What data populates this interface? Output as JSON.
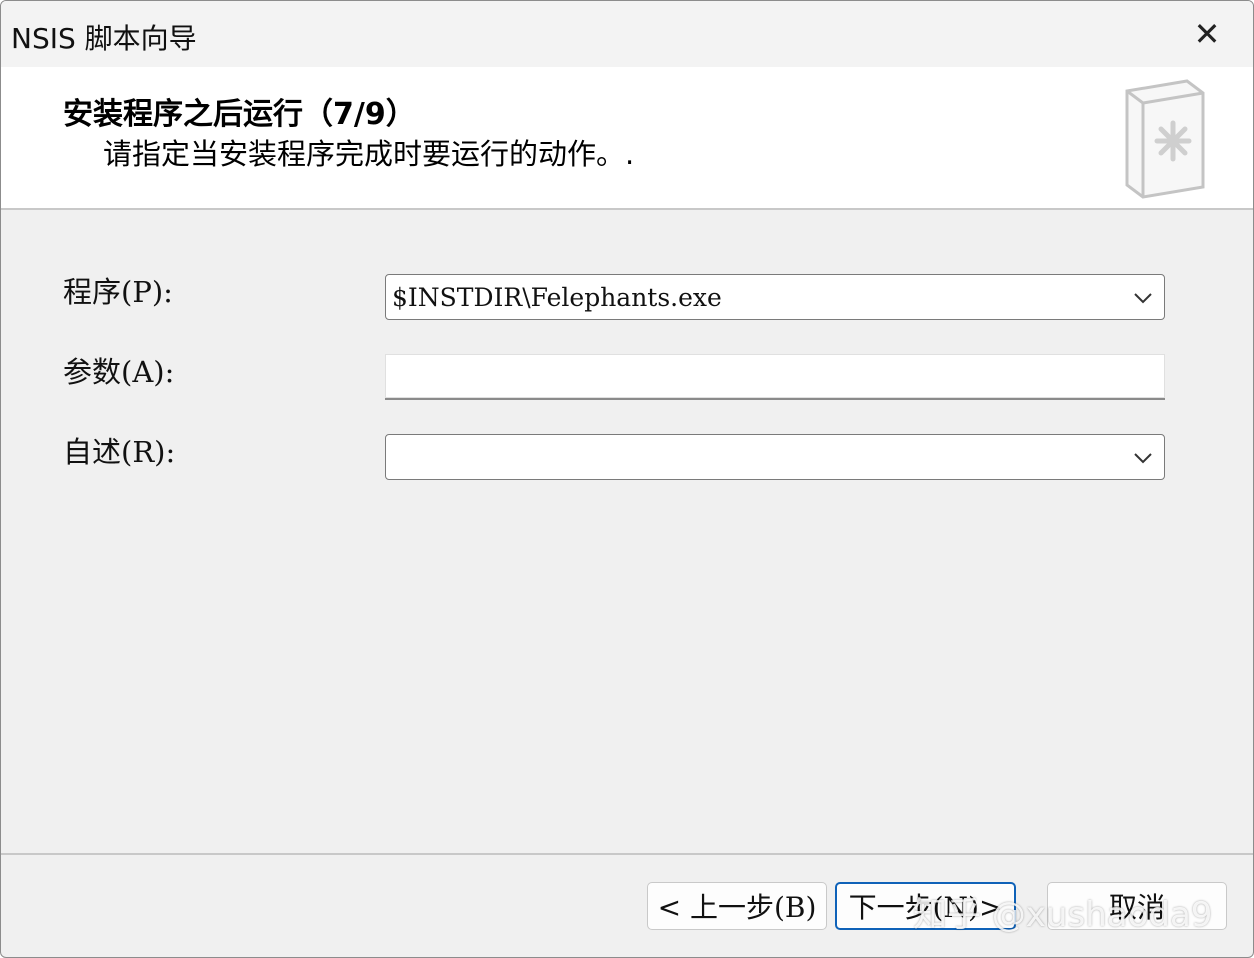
{
  "window": {
    "title": "NSIS 脚本向导",
    "close_glyph": "✕"
  },
  "header": {
    "title": "安装程序之后运行（7/9）",
    "subtitle": "请指定当安装程序完成时要运行的动作。."
  },
  "form": {
    "program_label": "程序(P):",
    "program_value": "$INSTDIR\\Felephants.exe",
    "params_label": "参数(A):",
    "params_value": "",
    "readme_label": "自述(R):",
    "readme_value": ""
  },
  "buttons": {
    "back": "< 上一步(B)",
    "next": "下一步(N)>",
    "cancel": "取消"
  },
  "watermark": "知乎 @xushaoda9",
  "colors": {
    "primary_border": "#0f62b8",
    "background": "#f0f0f0"
  }
}
